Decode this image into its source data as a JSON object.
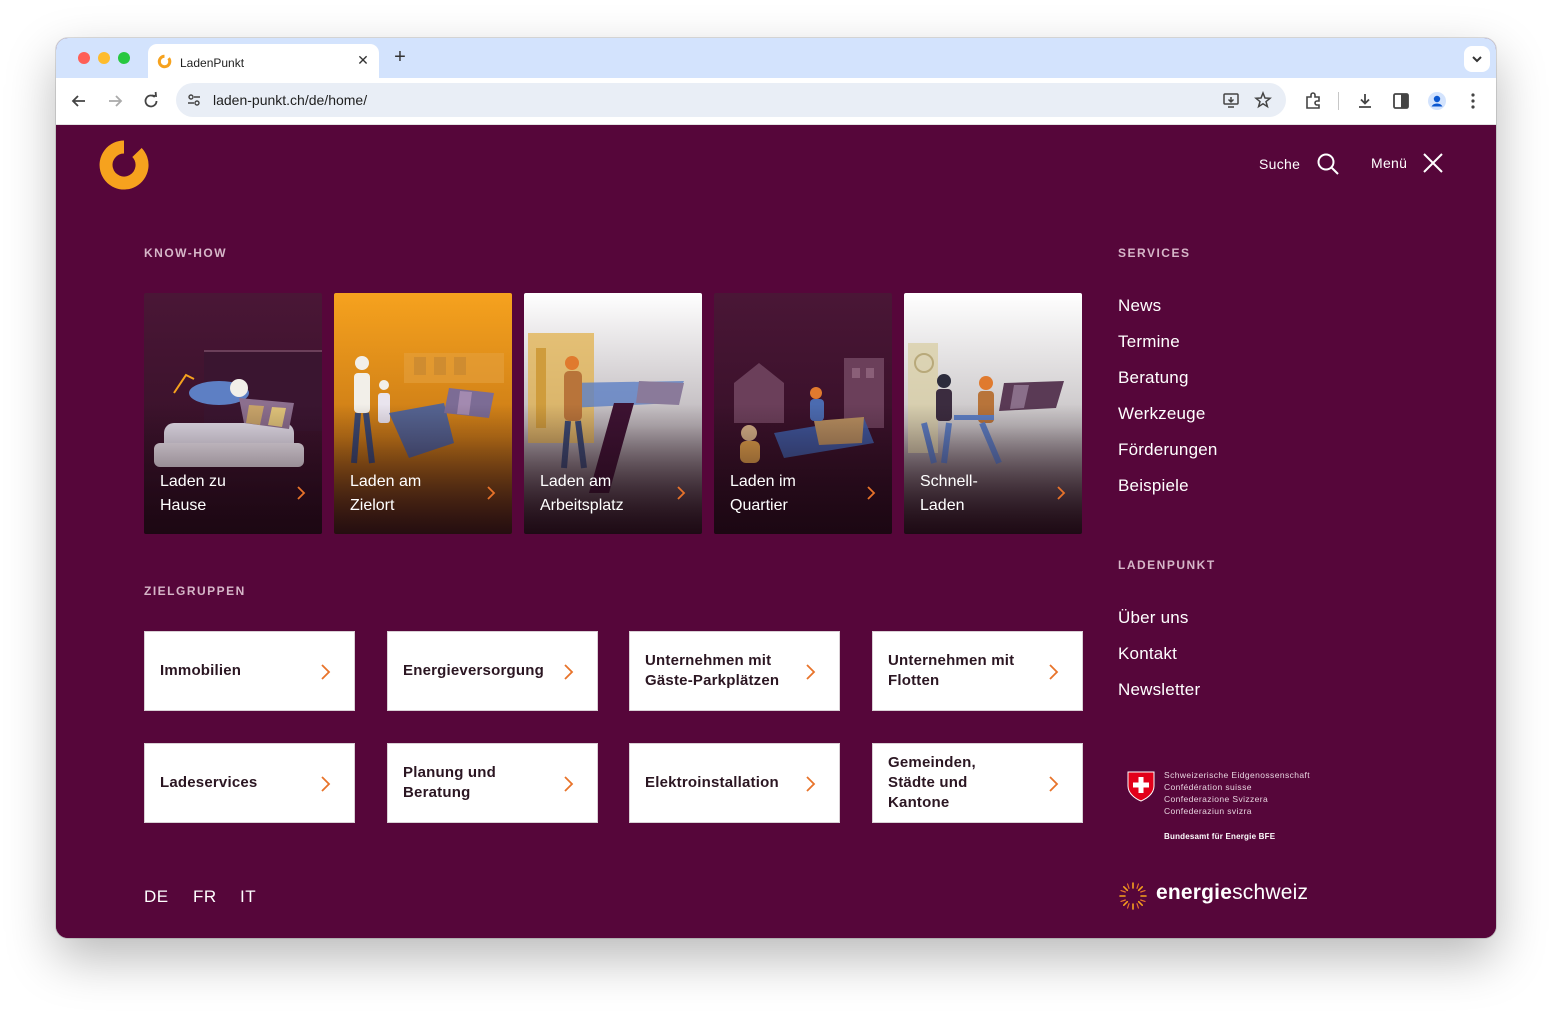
{
  "browser": {
    "tab_title": "LadenPunkt",
    "url": "laden-punkt.ch/de/home/",
    "traffic_colors": [
      "#ff5f57",
      "#febc2e",
      "#28c840"
    ]
  },
  "header": {
    "search_label": "Suche",
    "menu_label": "Menü"
  },
  "knowhow": {
    "label": "KNOW-HOW",
    "cards": [
      {
        "line1": "Laden zu",
        "line2": "Hause"
      },
      {
        "line1": "Laden am",
        "line2": "Zielort"
      },
      {
        "line1": "Laden am",
        "line2": "Arbeitsplatz"
      },
      {
        "line1": "Laden im",
        "line2": "Quartier"
      },
      {
        "line1": "Schnell-",
        "line2": "Laden"
      }
    ]
  },
  "zielgruppen": {
    "label": "ZIELGRUPPEN",
    "tiles": [
      {
        "label": "Immobilien"
      },
      {
        "label": "Energieversorgung"
      },
      {
        "label": "Unternehmen mit Gäste-Parkplätzen"
      },
      {
        "label": "Unternehmen mit Flotten"
      },
      {
        "label": "Ladeservices"
      },
      {
        "label": "Planung und Beratung"
      },
      {
        "label": "Elektroinstallation"
      },
      {
        "label": "Gemeinden, Städte und Kantone"
      }
    ]
  },
  "services": {
    "label": "SERVICES",
    "links": [
      "News",
      "Termine",
      "Beratung",
      "Werkzeuge",
      "Förderungen",
      "Beispiele"
    ]
  },
  "ladenpunkt": {
    "label": "LADENPUNKT",
    "links": [
      "Über uns",
      "Kontakt",
      "Newsletter"
    ]
  },
  "languages": [
    "DE",
    "FR",
    "IT"
  ],
  "footer": {
    "confed_lines": [
      "Schweizerische Eidgenossenschaft",
      "Confédération suisse",
      "Confederazione Svizzera",
      "Confederaziun svizra"
    ],
    "bfe": "Bundesamt für Energie BFE",
    "es_bold": "energie",
    "es_light": "schweiz"
  },
  "colors": {
    "page_bg": "#56063a",
    "accent_orange": "#f6a21e",
    "arrow_orange": "#e8732a"
  }
}
